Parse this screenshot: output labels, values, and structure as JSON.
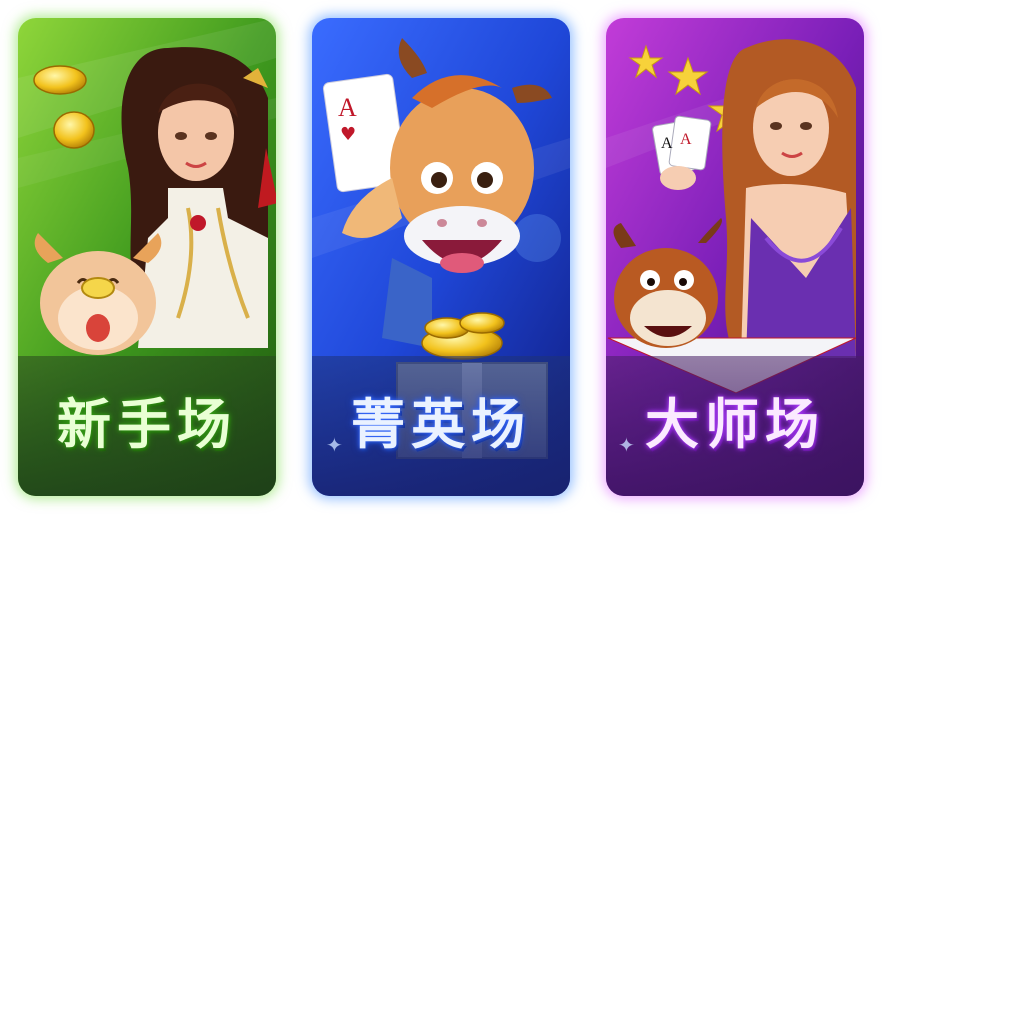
{
  "rooms": [
    {
      "id": "novice",
      "title": "新手场",
      "theme_color": "#4fb82a",
      "characters": [
        "woman-icon",
        "bull-mascot-icon",
        "gold-coin-icon"
      ]
    },
    {
      "id": "elite",
      "title": "菁英场",
      "theme_color": "#2c6cf0",
      "characters": [
        "bull-mascot-icon",
        "ace-of-hearts-icon",
        "gold-coin-icon",
        "gift-box-icon"
      ]
    },
    {
      "id": "master",
      "title": "大师场",
      "theme_color": "#9a2fd6",
      "characters": [
        "woman-icon",
        "bull-mascot-icon",
        "playing-cards-icon",
        "star-icon"
      ]
    }
  ]
}
